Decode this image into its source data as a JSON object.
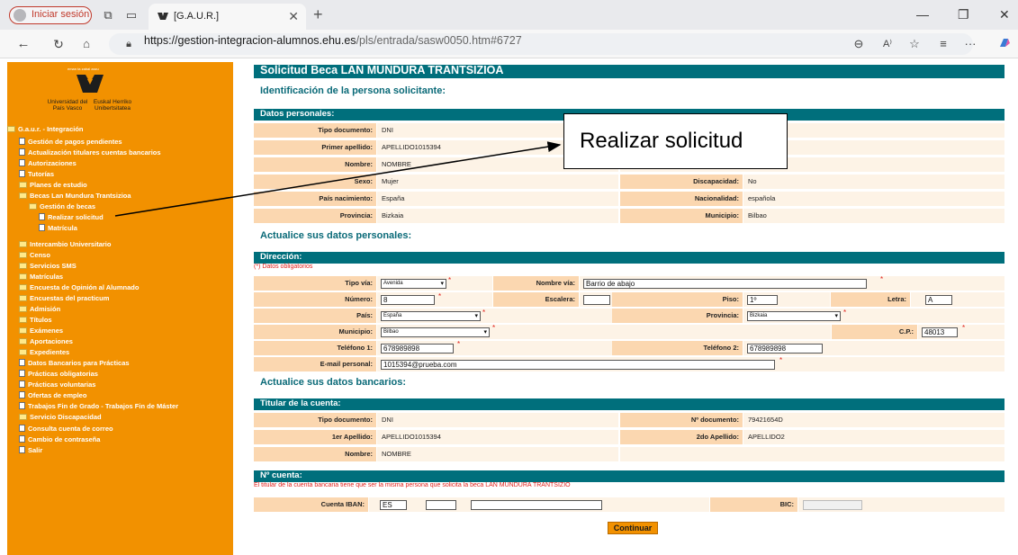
{
  "browser": {
    "login_label": "Iniciar sesión",
    "tab_title": "[G.A.U.R.]",
    "url_host": "https://gestion-integracion-alumnos.ehu.es",
    "url_path": "/pls/entrada/sasw0050.htm#6727",
    "icons": [
      "tab-actions-icon",
      "tabs-icon",
      "close-icon",
      "new-tab-icon",
      "minimize-icon",
      "restore-icon",
      "window-close-icon",
      "back-icon",
      "refresh-icon",
      "home-icon",
      "lock-icon",
      "zoom-icon",
      "read-aloud-icon",
      "favorite-icon",
      "collections-icon",
      "more-icon",
      "copilot-icon"
    ]
  },
  "sidebar": {
    "logo_top": "eman ta zabal zazu",
    "logo_left": "Universidad\ndel País Vasco",
    "logo_right": "Euskal Herriko\nUnibertsitatea",
    "items": [
      {
        "label": "G.a.u.r. - Integración",
        "icon": "folder-open-icon"
      },
      {
        "label": "Gestión de pagos pendientes",
        "icon": "page-icon"
      },
      {
        "label": "Actualización titulares cuentas bancarios",
        "icon": "page-icon"
      },
      {
        "label": "Autorizaciones",
        "icon": "page-icon"
      },
      {
        "label": "Tutorías",
        "icon": "page-icon"
      },
      {
        "label": "Planes de estudio",
        "icon": "folder-icon"
      },
      {
        "label": "Becas Lan Mundura Trantsizioa",
        "icon": "folder-open-icon"
      },
      {
        "label": "Gestión de becas",
        "icon": "folder-open-icon"
      },
      {
        "label": "Realizar solicitud",
        "icon": "page-icon"
      },
      {
        "label": "Matrícula",
        "icon": "page-icon"
      },
      {
        "label": "Intercambio Universitario",
        "icon": "folder-icon"
      },
      {
        "label": "Censo",
        "icon": "folder-icon"
      },
      {
        "label": "Servicios SMS",
        "icon": "folder-icon"
      },
      {
        "label": "Matrículas",
        "icon": "folder-icon"
      },
      {
        "label": "Encuesta de Opinión al Alumnado",
        "icon": "folder-icon"
      },
      {
        "label": "Encuestas del practicum",
        "icon": "folder-icon"
      },
      {
        "label": "Admisión",
        "icon": "folder-icon"
      },
      {
        "label": "Títulos",
        "icon": "folder-icon"
      },
      {
        "label": "Exámenes",
        "icon": "folder-icon"
      },
      {
        "label": "Aportaciones",
        "icon": "folder-icon"
      },
      {
        "label": "Expedientes",
        "icon": "folder-icon"
      },
      {
        "label": "Datos Bancarios para Prácticas",
        "icon": "page-icon"
      },
      {
        "label": "Prácticas obligatorias",
        "icon": "page-icon"
      },
      {
        "label": "Prácticas voluntarias",
        "icon": "page-icon"
      },
      {
        "label": "Ofertas de empleo",
        "icon": "page-icon"
      },
      {
        "label": "Trabajos Fin de Grado - Trabajos Fin de Máster",
        "icon": "page-icon"
      },
      {
        "label": "Servicio Discapacidad",
        "icon": "folder-icon"
      },
      {
        "label": "Consulta cuenta de correo",
        "icon": "page-icon"
      },
      {
        "label": "Cambio de contraseña",
        "icon": "page-icon"
      },
      {
        "label": "Salir",
        "icon": "page-icon"
      }
    ]
  },
  "main": {
    "title": "Solicitud Beca LAN MUNDURA TRANTSIZIOA",
    "section_identification": "Identificación de la persona solicitante:",
    "datos_personales_header": "Datos personales:",
    "personal": {
      "tipo_documento_label": "Tipo documento:",
      "tipo_documento": "DNI",
      "primer_apellido_label": "Primer apellido:",
      "primer_apellido": "APELLIDO1015394",
      "nombre_label": "Nombre:",
      "nombre": "NOMBRE",
      "sexo_label": "Sexo:",
      "sexo": "Mujer",
      "discapacidad_label": "Discapacidad:",
      "discapacidad": "No",
      "pais_nacimiento_label": "País nacimiento:",
      "pais_nacimiento": "España",
      "nacionalidad_label": "Nacionalidad:",
      "nacionalidad": "española",
      "provincia_label": "Provincia:",
      "provincia": "Bizkaia",
      "municipio_label": "Municipio:",
      "municipio": "Bilbao"
    },
    "section_update_personal": "Actualice sus datos personales:",
    "direccion_header": "Dirección:",
    "required_note": "(*) Datos obligatorios",
    "address": {
      "tipo_via_label": "Tipo vía:",
      "tipo_via": "Avenida",
      "nombre_via_label": "Nombre vía:",
      "nombre_via": "Barrio de abajo",
      "numero_label": "Número:",
      "numero": "8",
      "escalera_label": "Escalera:",
      "escalera": "",
      "piso_label": "Piso:",
      "piso": "1º",
      "letra_label": "Letra:",
      "letra": "A",
      "pais_label": "País:",
      "pais": "España",
      "provincia_label": "Provincia:",
      "provincia": "Bizkaia",
      "municipio_label": "Municipio:",
      "municipio": "Bilbao",
      "cp_label": "C.P.:",
      "cp": "48013",
      "telefono1_label": "Teléfono 1:",
      "telefono1": "678989898",
      "telefono2_label": "Teléfono 2:",
      "telefono2": "678989898",
      "email_label": "E-mail personal:",
      "email": "1015394@prueba.com",
      "asterisk": "*"
    },
    "section_update_bank": "Actualice sus datos bancarios:",
    "titular_header": "Titular de la cuenta:",
    "titular": {
      "tipo_documento_label": "Tipo documento:",
      "tipo_documento": "DNI",
      "n_documento_label": "Nº documento:",
      "n_documento": "79421654D",
      "apellido1_label": "1er Apellido:",
      "apellido1": "APELLIDO1015394",
      "apellido2_label": "2do Apellido:",
      "apellido2": "APELLIDO2",
      "nombre_label": "Nombre:",
      "nombre": "NOMBRE"
    },
    "cuenta_header": "Nº cuenta:",
    "cuenta_note": "El titular de la cuenta bancaria tiene que ser la misma persona que solicita la beca LAN MUNDURA TRANTSIZIO",
    "cuenta": {
      "iban_label": "Cuenta IBAN:",
      "iban_country": "ES",
      "bic_label": "BIC:"
    },
    "continue_button": "Continuar"
  },
  "annotation": {
    "callout_text": "Realizar solicitud",
    "arrow_color": "#000000"
  },
  "colors": {
    "sidebar": "#f29100",
    "header_teal": "#006f7c",
    "label_bg": "#fbd7b0",
    "value_bg": "#fdf3e6",
    "required_red": "#e0201b"
  }
}
